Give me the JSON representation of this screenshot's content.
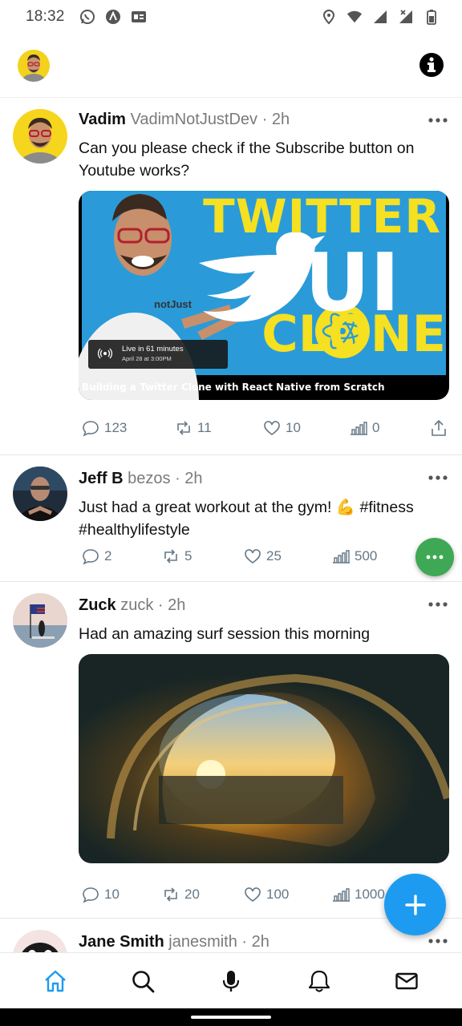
{
  "status_bar": {
    "time": "18:32",
    "left_icons": [
      "whatsapp-icon",
      "app-icon",
      "translate-icon"
    ],
    "right_icons": [
      "location-icon",
      "wifi-icon",
      "signal-icon",
      "signal-x-icon",
      "battery-icon"
    ]
  },
  "header": {
    "avatar": "profile-avatar",
    "info_icon": "info-icon"
  },
  "posts": [
    {
      "name": "Vadim",
      "handle": "VadimNotJustDev",
      "time": "2h",
      "text": "Can you please check if the Subscribe button on Youtube works?",
      "media": {
        "kind": "thumbnail",
        "title_line1": "TWITTER",
        "title_line2": "UI",
        "title_line3": "CLONE",
        "shirt_text": "notJust",
        "live_label": "Live in 61 minutes",
        "live_date": "April 28 at 3:00PM",
        "caption": "Building a Twitter Clone with React Native from Scratch"
      },
      "comments": "123",
      "retweets": "11",
      "likes": "10",
      "impressions": "0"
    },
    {
      "name": "Jeff B",
      "handle": "bezos",
      "time": "2h",
      "text": "Just had a great workout at the gym! 💪 #fitness #healthylifestyle",
      "comments": "2",
      "retweets": "5",
      "likes": "25",
      "impressions": "500"
    },
    {
      "name": "Zuck",
      "handle": "zuck",
      "time": "2h",
      "text": "Had an amazing surf session this morning",
      "comments": "10",
      "retweets": "20",
      "likes": "100",
      "impressions": "1000"
    },
    {
      "name": "Jane Smith",
      "handle": "janesmith",
      "time": "2h"
    }
  ],
  "separator": "·",
  "nav": [
    "home-icon",
    "search-icon",
    "microphone-icon",
    "bell-icon",
    "mail-icon"
  ],
  "colors": {
    "accent": "#1d9bf0",
    "green_fab": "#3fa854",
    "muted": "#7a7a7a",
    "thumbnail_blue": "#2a9bd8",
    "thumbnail_yellow": "#f5e021"
  }
}
